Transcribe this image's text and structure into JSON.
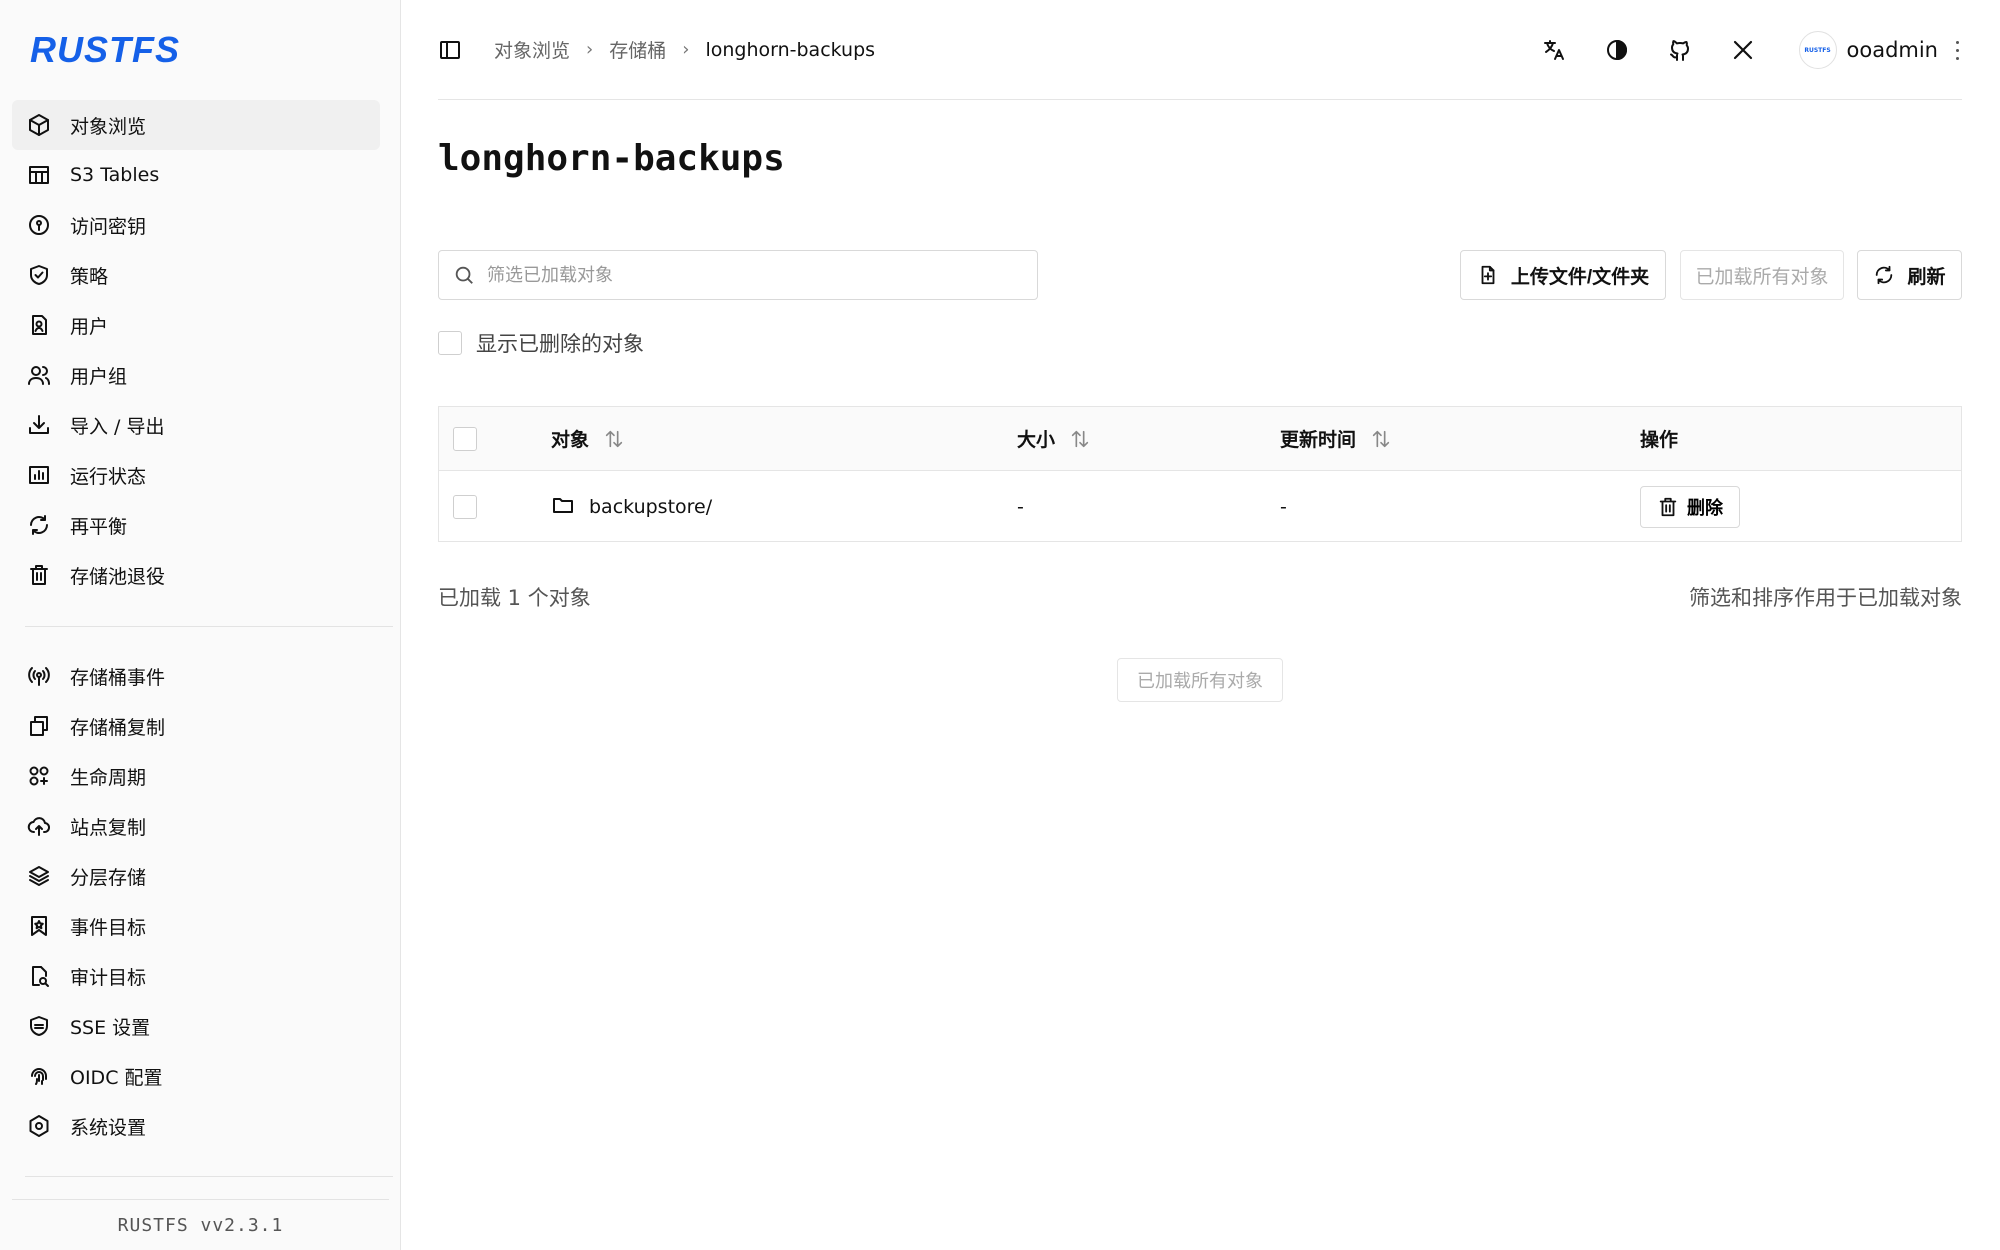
{
  "brand": {
    "logo": "RUSTFS",
    "version": "RUSTFS  vv2.3.1",
    "avatar_text": "RUSTFS",
    "color": "#1560e8"
  },
  "sidebar": {
    "group1": [
      {
        "label": "对象浏览",
        "icon": "box-icon",
        "active": true
      },
      {
        "label": "S3 Tables",
        "icon": "table-icon"
      },
      {
        "label": "访问密钥",
        "icon": "key-icon"
      },
      {
        "label": "策略",
        "icon": "shield-check-icon"
      },
      {
        "label": "用户",
        "icon": "user-badge-icon"
      },
      {
        "label": "用户组",
        "icon": "users-icon"
      },
      {
        "label": "导入 / 导出",
        "icon": "download-icon"
      },
      {
        "label": "运行状态",
        "icon": "bar-chart-icon"
      },
      {
        "label": "再平衡",
        "icon": "refresh-icon"
      },
      {
        "label": "存储池退役",
        "icon": "trash-icon"
      }
    ],
    "group2": [
      {
        "label": "存储桶事件",
        "icon": "broadcast-icon"
      },
      {
        "label": "存储桶复制",
        "icon": "copy-icon"
      },
      {
        "label": "生命周期",
        "icon": "lifecycle-icon"
      },
      {
        "label": "站点复制",
        "icon": "cloud-upload-icon"
      },
      {
        "label": "分层存储",
        "icon": "layers-icon"
      },
      {
        "label": "事件目标",
        "icon": "bookmark-star-icon"
      },
      {
        "label": "审计目标",
        "icon": "file-search-icon"
      },
      {
        "label": "SSE 设置",
        "icon": "lock-shield-icon"
      },
      {
        "label": "OIDC 配置",
        "icon": "fingerprint-icon"
      },
      {
        "label": "系统设置",
        "icon": "settings-hex-icon"
      }
    ]
  },
  "header": {
    "breadcrumb": [
      "对象浏览",
      "存储桶",
      "longhorn-backups"
    ],
    "user": "ooadmin"
  },
  "main": {
    "title": "longhorn-backups",
    "search_placeholder": "筛选已加载对象",
    "upload_label": "上传文件/文件夹",
    "loaded_all_label": "已加载所有对象",
    "refresh_label": "刷新",
    "show_deleted_label": "显示已删除的对象",
    "columns": {
      "object": "对象",
      "size": "大小",
      "updated": "更新时间",
      "actions": "操作"
    },
    "rows": [
      {
        "name": "backupstore/",
        "size": "-",
        "updated": "-",
        "action": "删除"
      }
    ],
    "loaded_count": "已加载 1 个对象",
    "filter_note": "筛选和排序作用于已加载对象",
    "center_loaded_label": "已加载所有对象"
  }
}
